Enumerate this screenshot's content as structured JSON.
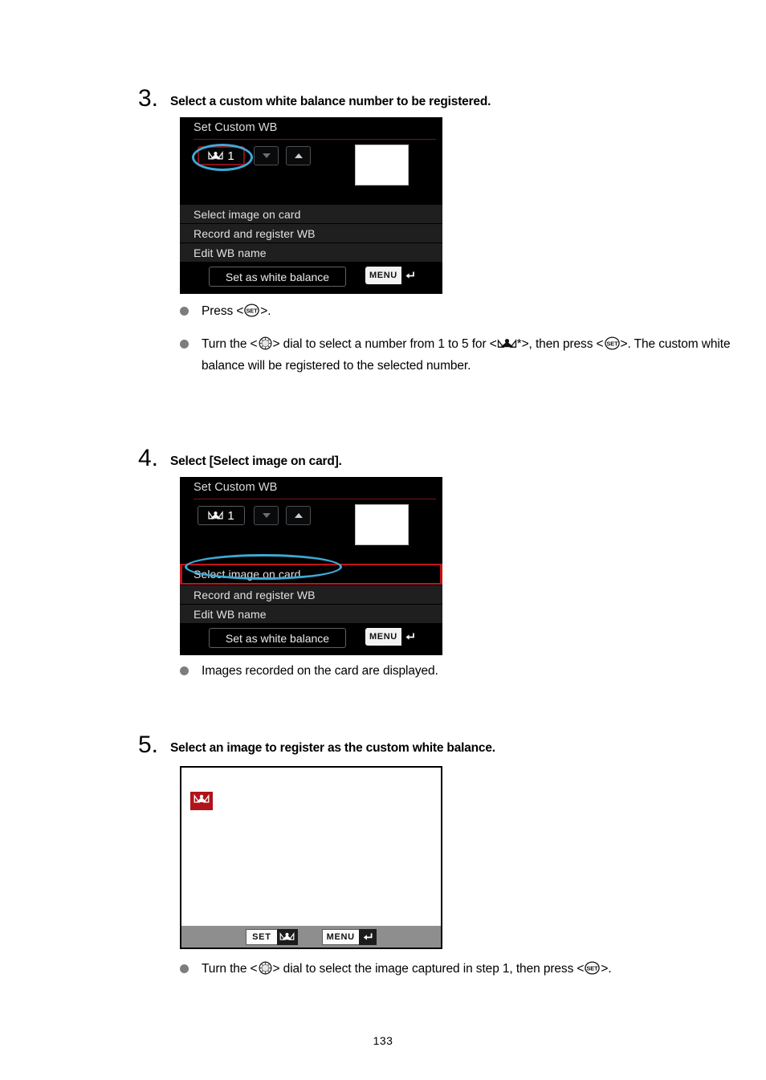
{
  "page": {
    "number": "133"
  },
  "steps": [
    {
      "num": "3.",
      "title": "Select a custom white balance number to be registered.",
      "screen": {
        "title": "Set Custom WB",
        "wb_number": "1",
        "wb_icon": "custom-wb-icon",
        "down_arrow_icon": "chevron-down-icon",
        "up_arrow_icon": "chevron-up-icon",
        "thumbnail": "white-thumbnail",
        "rows": [
          "Select image on card",
          "Record and register WB",
          "Edit WB name"
        ],
        "selected_row_index": -1,
        "selected_wb_box": true,
        "footer_button": "Set as white balance",
        "menu_label": "MENU",
        "menu_return_icon": "return-arrow-icon"
      },
      "bullets": [
        {
          "segments": [
            {
              "t": "text",
              "v": "Press < "
            },
            {
              "t": "icon",
              "v": "set-button-icon"
            },
            {
              "t": "text",
              "v": " >."
            }
          ]
        },
        {
          "segments": [
            {
              "t": "text",
              "v": "Turn the < "
            },
            {
              "t": "icon",
              "v": "quick-control-dial-icon"
            },
            {
              "t": "text",
              "v": " > dial to select a number from 1 to 5 for < "
            },
            {
              "t": "icon",
              "v": "custom-wb-icon"
            },
            {
              "t": "text",
              "v": "*>, then press < "
            },
            {
              "t": "icon",
              "v": "set-button-icon"
            },
            {
              "t": "text",
              "v": " >. The custom white balance will be registered to the selected number."
            }
          ]
        }
      ]
    },
    {
      "num": "4.",
      "title": "Select [Select image on card].",
      "screen": {
        "title": "Set Custom WB",
        "wb_number": "1",
        "wb_icon": "custom-wb-icon",
        "down_arrow_icon": "chevron-down-icon",
        "up_arrow_icon": "chevron-up-icon",
        "thumbnail": "white-thumbnail",
        "rows": [
          "Select image on card",
          "Record and register WB",
          "Edit WB name"
        ],
        "selected_row_index": 0,
        "selected_wb_box": false,
        "footer_button": "Set as white balance",
        "menu_label": "MENU",
        "menu_return_icon": "return-arrow-icon"
      },
      "bullets": [
        {
          "segments": [
            {
              "t": "text",
              "v": "Images recorded on the card are displayed."
            }
          ]
        }
      ]
    },
    {
      "num": "5.",
      "title": "Select an image to register as the custom white balance.",
      "photo_screen": {
        "badge_icon": "custom-wb-icon",
        "set_label": "SET",
        "set_icon": "custom-wb-icon",
        "menu_label": "MENU",
        "menu_return_icon": "return-arrow-icon"
      },
      "bullets": [
        {
          "segments": [
            {
              "t": "text",
              "v": "Turn the < "
            },
            {
              "t": "icon",
              "v": "quick-control-dial-icon"
            },
            {
              "t": "text",
              "v": " > dial to select the image captured in step 1, then press < "
            },
            {
              "t": "icon",
              "v": "set-button-icon"
            },
            {
              "t": "text",
              "v": " >."
            }
          ]
        }
      ]
    }
  ],
  "colors": {
    "callout": "#3fa9d4",
    "menu_accent": "#c01419",
    "badge_red": "#b01319",
    "title_rule": "#7b1216"
  }
}
